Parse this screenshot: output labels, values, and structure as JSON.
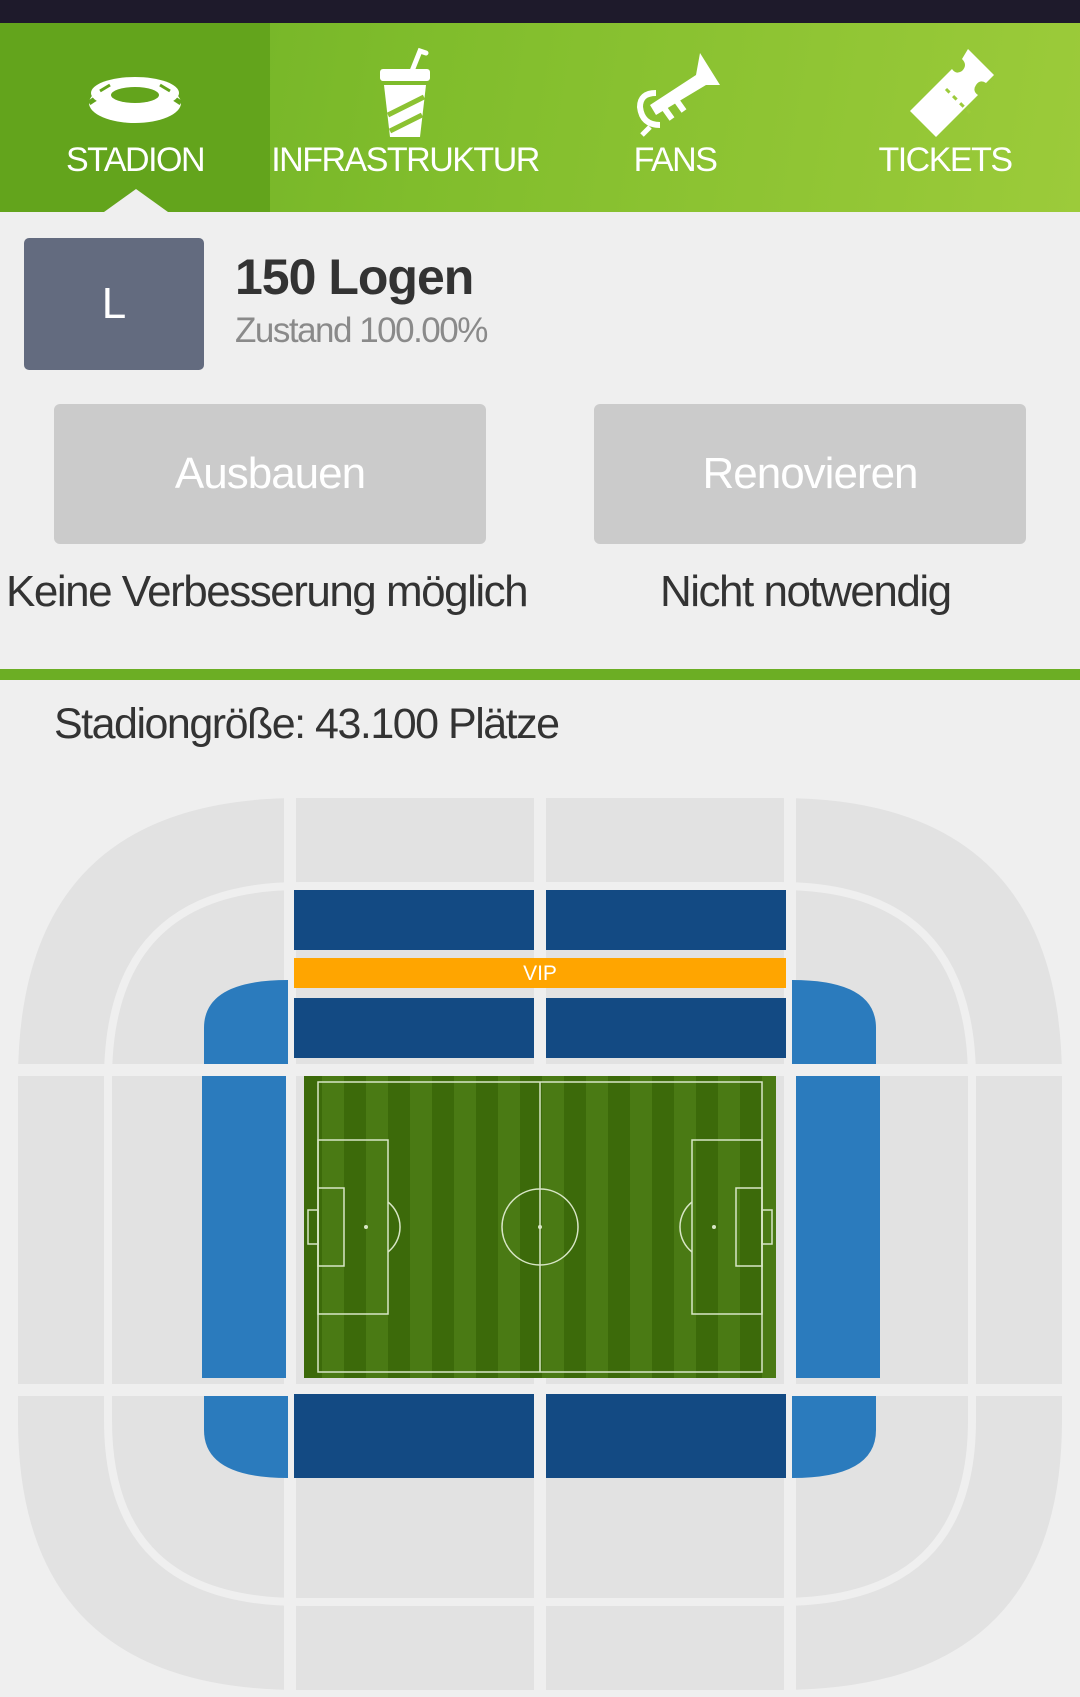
{
  "tabs": [
    {
      "label": "STADION",
      "icon": "stadium-icon",
      "active": true
    },
    {
      "label": "INFRASTRUKTUR",
      "icon": "drink-cup-icon",
      "active": false
    },
    {
      "label": "FANS",
      "icon": "trumpet-icon",
      "active": false
    },
    {
      "label": "TICKETS",
      "icon": "ticket-icon",
      "active": false
    }
  ],
  "item": {
    "badge": "L",
    "title": "150 Logen",
    "condition": "Zustand 100.00%"
  },
  "actions": {
    "upgrade_label": "Ausbauen",
    "upgrade_note": "Keine Verbesserung möglich",
    "renovate_label": "Renovieren",
    "renovate_note": "Nicht notwendig"
  },
  "stadium": {
    "size_text": "Stadiongröße: 43.100 Plätze",
    "vip_label": "VIP"
  },
  "colors": {
    "accent_green": "#6cae24",
    "badge_gray": "#636b7f",
    "seat_dark_blue": "#134a83",
    "seat_light_blue": "#2b7bbd",
    "vip_orange": "#ffa500",
    "pitch_green": "#3c6a0a",
    "empty_section": "#e2e2e2"
  }
}
